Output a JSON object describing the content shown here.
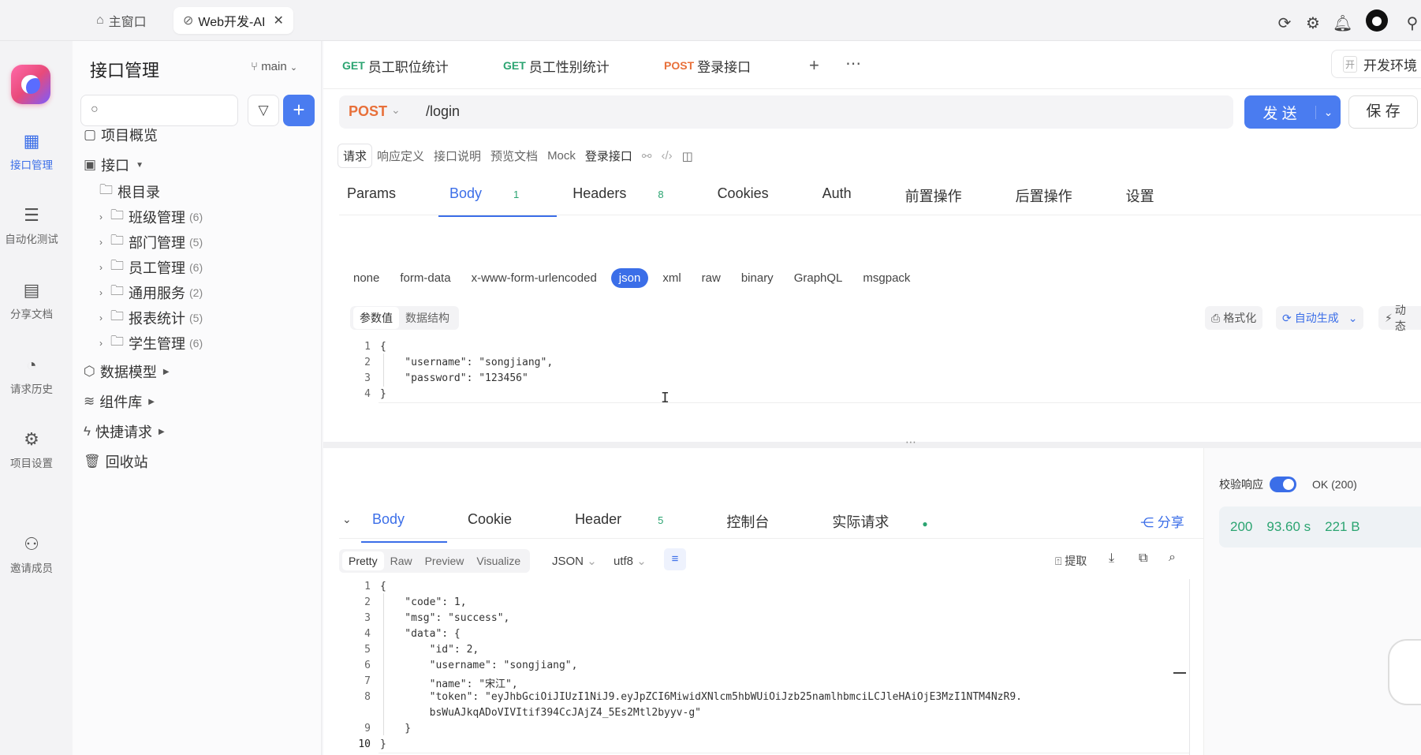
{
  "window_tabs": [
    {
      "label": "主窗口",
      "icon": "home-icon"
    },
    {
      "label": "Web开发-AI",
      "icon": "folder-icon"
    }
  ],
  "rail": [
    {
      "label": "接口管理"
    },
    {
      "label": "自动化测试"
    },
    {
      "label": "分享文档"
    },
    {
      "label": "请求历史"
    },
    {
      "label": "项目设置"
    },
    {
      "label": "邀请成员"
    }
  ],
  "sidebar": {
    "title": "接口管理",
    "branch": "main",
    "items": {
      "overview": "项目概览",
      "apis": "接口",
      "root": "根目录",
      "folders": [
        {
          "label": "班级管理",
          "count": "(6)"
        },
        {
          "label": "部门管理",
          "count": "(5)"
        },
        {
          "label": "员工管理",
          "count": "(6)"
        },
        {
          "label": "通用服务",
          "count": "(2)"
        },
        {
          "label": "报表统计",
          "count": "(5)"
        },
        {
          "label": "学生管理",
          "count": "(6)"
        }
      ],
      "models": "数据模型",
      "components": "组件库",
      "quick": "快捷请求",
      "trash": "回收站"
    }
  },
  "api_tabs": [
    {
      "method": "GET",
      "label": "员工职位统计"
    },
    {
      "method": "GET",
      "label": "员工性别统计"
    },
    {
      "method": "POST",
      "label": "登录接口"
    }
  ],
  "env": {
    "icon_text": "开",
    "label": "开发环境"
  },
  "request": {
    "method": "POST",
    "url": "/login",
    "send": "发 送",
    "save": "保 存",
    "subtabs": [
      "请求",
      "响应定义",
      "接口说明",
      "预览文档",
      "Mock",
      "登录接口"
    ],
    "tabs": [
      {
        "label": "Params",
        "badge": ""
      },
      {
        "label": "Body",
        "badge": "1"
      },
      {
        "label": "Headers",
        "badge": "8"
      },
      {
        "label": "Cookies",
        "badge": ""
      },
      {
        "label": "Auth",
        "badge": ""
      },
      {
        "label": "前置操作",
        "badge": ""
      },
      {
        "label": "后置操作",
        "badge": ""
      },
      {
        "label": "设置",
        "badge": ""
      }
    ],
    "body_types": [
      "none",
      "form-data",
      "x-www-form-urlencoded",
      "json",
      "xml",
      "raw",
      "binary",
      "GraphQL",
      "msgpack"
    ],
    "selected_body_type": "json",
    "segments": [
      "参数值",
      "数据结构"
    ],
    "tools": {
      "format": "格式化",
      "autogen": "自动生成",
      "dynamic": "动态"
    },
    "code_lines": [
      {
        "n": "1",
        "t": "{"
      },
      {
        "n": "2",
        "t": "    \"username\": \"songjiang\","
      },
      {
        "n": "3",
        "t": "    \"password\": \"123456\""
      },
      {
        "n": "4",
        "t": "}"
      }
    ]
  },
  "response": {
    "tabs": [
      {
        "label": "Body",
        "badge": ""
      },
      {
        "label": "Cookie",
        "badge": ""
      },
      {
        "label": "Header",
        "badge": "5"
      },
      {
        "label": "控制台",
        "badge": ""
      },
      {
        "label": "实际请求",
        "badge": ""
      }
    ],
    "share": "分享",
    "views": [
      "Pretty",
      "Raw",
      "Preview",
      "Visualize"
    ],
    "format": "JSON",
    "encoding": "utf8",
    "extract": "提取",
    "validate_label": "校验响应",
    "status_text": "OK (200)",
    "status_code": "200",
    "time": "93.60 s",
    "size": "221 B",
    "code_lines": [
      {
        "n": "1",
        "t": "{"
      },
      {
        "n": "2",
        "t": "    \"code\": 1,"
      },
      {
        "n": "3",
        "t": "    \"msg\": \"success\","
      },
      {
        "n": "4",
        "t": "    \"data\": {"
      },
      {
        "n": "5",
        "t": "        \"id\": 2,"
      },
      {
        "n": "6",
        "t": "        \"username\": \"songjiang\","
      },
      {
        "n": "7",
        "t": "        \"name\": \"宋江\","
      },
      {
        "n": "8",
        "t": "        \"token\": \"eyJhbGciOiJIUzI1NiJ9.eyJpZCI6MiwidXNlcm5hbWUiOiJzb25namlhbmciLCJleHAiOjE3MzI1NTM4NzR9."
      },
      {
        "n": "",
        "t": "        bsWuAJkqADoVIVItif394CcJAjZ4_5Es2Mtl2byyv-g\""
      },
      {
        "n": "9",
        "t": "    }"
      },
      {
        "n": "10",
        "t": "}"
      }
    ]
  }
}
